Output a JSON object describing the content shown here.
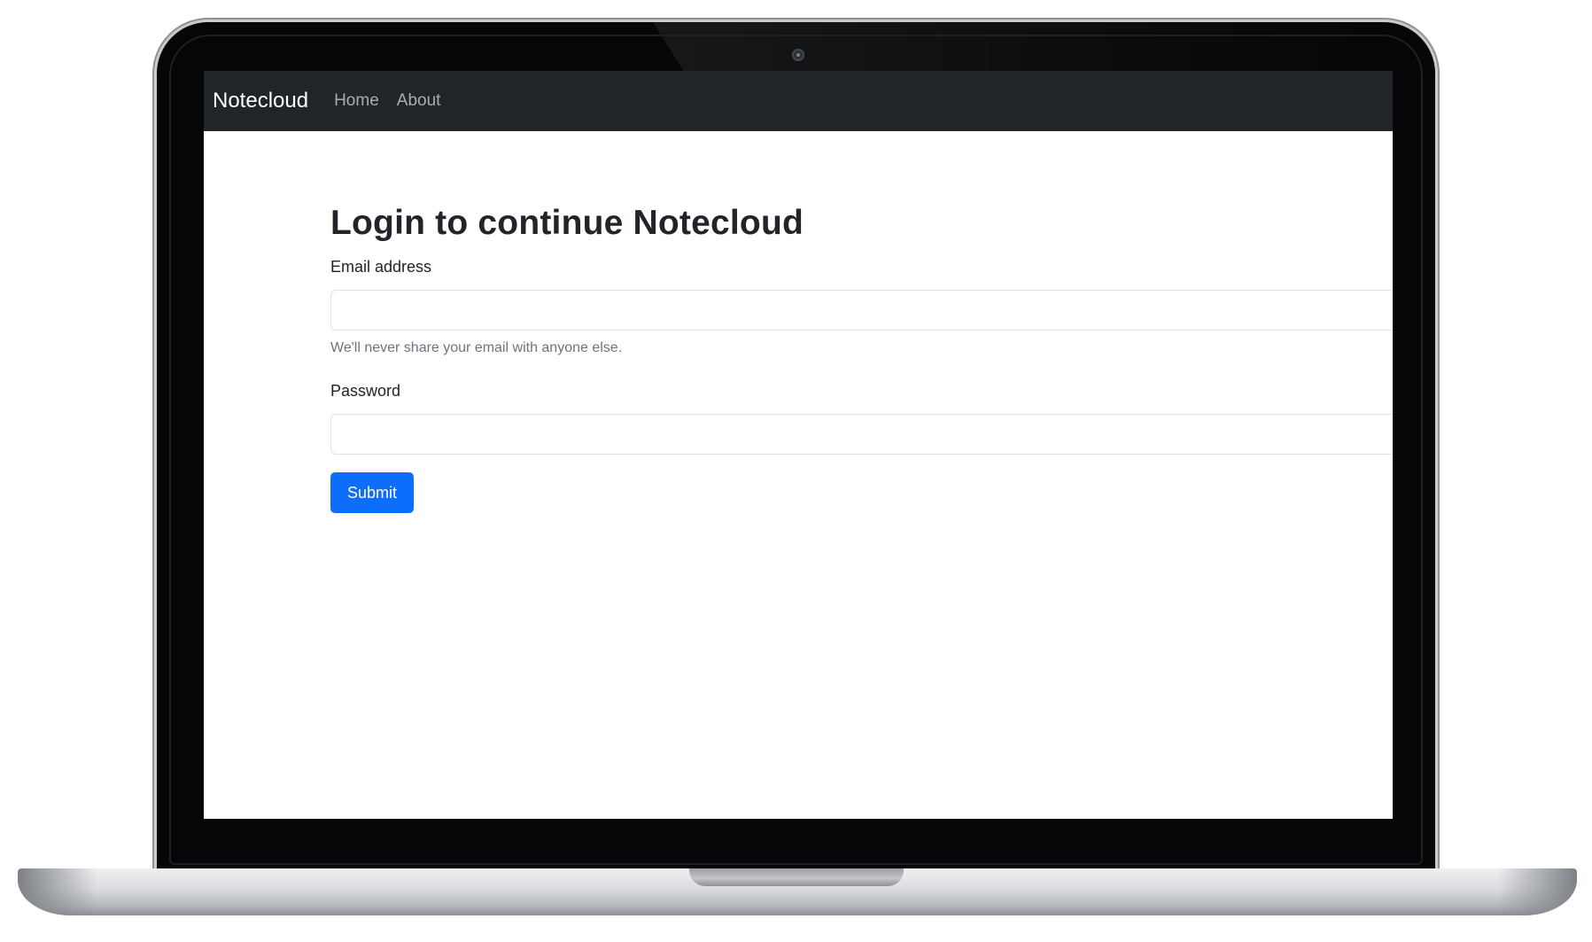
{
  "navbar": {
    "brand": "Notecloud",
    "links": [
      {
        "label": "Home"
      },
      {
        "label": "About"
      }
    ]
  },
  "login": {
    "title": "Login to continue Notecloud",
    "email_label": "Email address",
    "email_value": "",
    "email_help": "We'll never share your email with anyone else.",
    "password_label": "Password",
    "password_value": "",
    "submit_label": "Submit"
  },
  "colors": {
    "navbar_bg": "#212529",
    "primary": "#0d6efd",
    "laptop_bezel": "#050608"
  }
}
